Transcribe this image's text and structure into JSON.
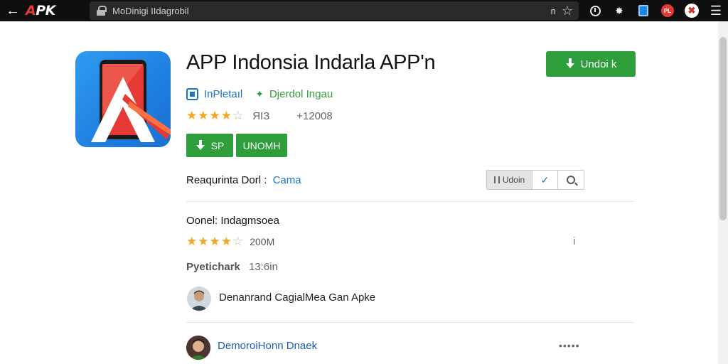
{
  "browser": {
    "logo": {
      "brand_a": "A",
      "brand_rest": "PK"
    },
    "url": "MoDinigi IIdagrobil",
    "url_action": "n",
    "toolbar_icons": [
      "history-icon",
      "extensions-icon",
      "blue-extension-icon",
      "red-extension-icon",
      "profile-avatar-icon",
      "menu-icon"
    ],
    "red_badge": "PL"
  },
  "app": {
    "title": "APP Indonsia Indarla APP'n",
    "install_label": "Undoi k",
    "developer": "InPletaıl",
    "category": "Djerdol Ingau",
    "rating": {
      "stars": 4,
      "max": 5,
      "count": "ЯІЗ",
      "downloads": "+12008"
    },
    "buttons": [
      {
        "label": "SP"
      },
      {
        "label": "UNOMH"
      }
    ],
    "colors": {
      "accent_green": "#2e9e3a",
      "link_blue": "#1a73c8",
      "star": "#f5a623"
    }
  },
  "requirements": {
    "label": "Reaqurinta Dorl :",
    "link": "Cama",
    "tools": [
      {
        "label": "Udoin"
      },
      {
        "icon": "check-icon"
      },
      {
        "icon": "search-icon"
      }
    ]
  },
  "review": {
    "title": "Oonel: Indagmsoea",
    "rating": {
      "stars": 4,
      "max": 5,
      "count": "200M"
    },
    "info_icon": "i",
    "publisher_label": "Pyetichark",
    "time": "13:6in"
  },
  "comments": [
    {
      "text": "Denanrand CagialMea Gan Apke"
    },
    {
      "text": "DemoroiHonn Dnaek",
      "more": "•••••"
    }
  ]
}
